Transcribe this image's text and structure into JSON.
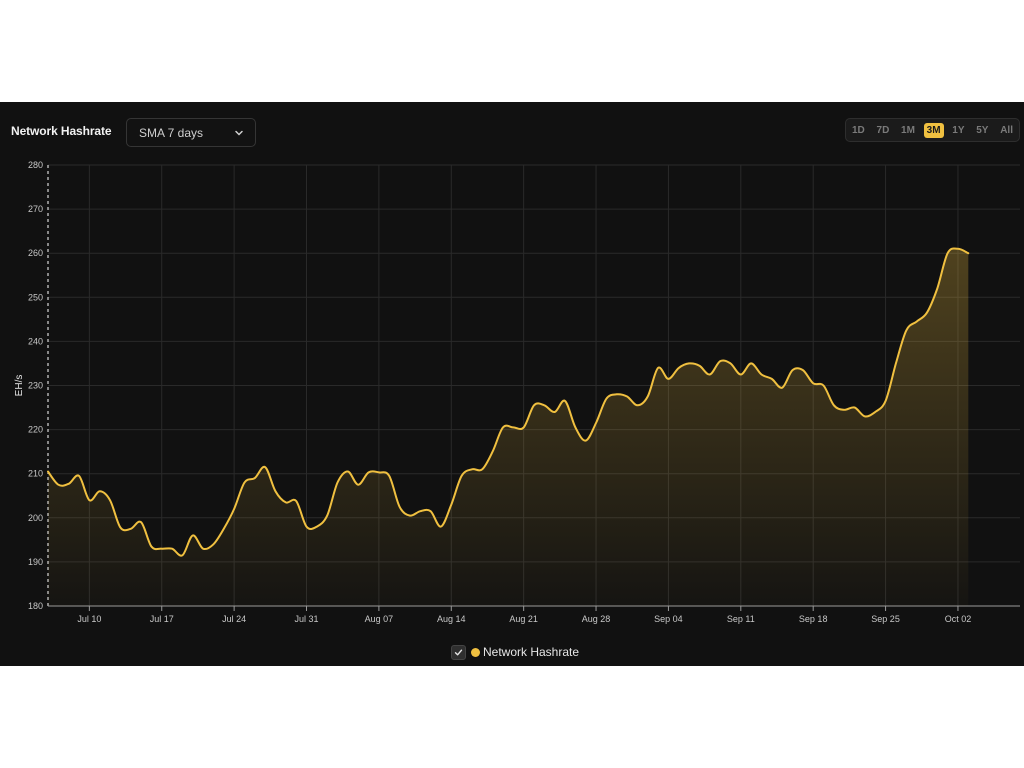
{
  "header": {
    "title": "Network Hashrate",
    "select_value": "SMA 7 days"
  },
  "ranges": [
    {
      "label": "1D",
      "active": false
    },
    {
      "label": "7D",
      "active": false
    },
    {
      "label": "1M",
      "active": false
    },
    {
      "label": "3M",
      "active": true
    },
    {
      "label": "1Y",
      "active": false
    },
    {
      "label": "5Y",
      "active": false
    },
    {
      "label": "All",
      "active": false
    }
  ],
  "colors": {
    "accent": "#f0c040",
    "background": "#111111",
    "grid": "#2a2a2a"
  },
  "legend": {
    "label": "Network Hashrate",
    "checked": true
  },
  "chart_data": {
    "type": "area",
    "ylabel": "EH/s",
    "ylim": [
      180,
      280
    ],
    "yticks": [
      180,
      190,
      200,
      210,
      220,
      230,
      240,
      250,
      260,
      270,
      280
    ],
    "xlim": [
      "2023-07-06",
      "2023-10-08"
    ],
    "xticks": [
      {
        "date": "2023-07-10",
        "label": "Jul 10"
      },
      {
        "date": "2023-07-17",
        "label": "Jul 17"
      },
      {
        "date": "2023-07-24",
        "label": "Jul 24"
      },
      {
        "date": "2023-07-31",
        "label": "Jul 31"
      },
      {
        "date": "2023-08-07",
        "label": "Aug 07"
      },
      {
        "date": "2023-08-14",
        "label": "Aug 14"
      },
      {
        "date": "2023-08-21",
        "label": "Aug 21"
      },
      {
        "date": "2023-08-28",
        "label": "Aug 28"
      },
      {
        "date": "2023-09-04",
        "label": "Sep 04"
      },
      {
        "date": "2023-09-11",
        "label": "Sep 11"
      },
      {
        "date": "2023-09-18",
        "label": "Sep 18"
      },
      {
        "date": "2023-09-25",
        "label": "Sep 25"
      },
      {
        "date": "2023-10-02",
        "label": "Oct 02"
      }
    ],
    "grid": true,
    "legend_position": "bottom-center",
    "series": [
      {
        "name": "Network Hashrate",
        "points": [
          [
            "2023-07-06",
            210.5
          ],
          [
            "2023-07-07",
            207.5
          ],
          [
            "2023-07-08",
            207.7
          ],
          [
            "2023-07-09",
            209.5
          ],
          [
            "2023-07-10",
            204.0
          ],
          [
            "2023-07-11",
            206.0
          ],
          [
            "2023-07-12",
            204.0
          ],
          [
            "2023-07-13",
            197.8
          ],
          [
            "2023-07-14",
            197.5
          ],
          [
            "2023-07-15",
            199.0
          ],
          [
            "2023-07-16",
            193.5
          ],
          [
            "2023-07-17",
            193.0
          ],
          [
            "2023-07-18",
            193.0
          ],
          [
            "2023-07-19",
            191.5
          ],
          [
            "2023-07-20",
            196.0
          ],
          [
            "2023-07-21",
            193.0
          ],
          [
            "2023-07-22",
            194.0
          ],
          [
            "2023-07-23",
            197.5
          ],
          [
            "2023-07-24",
            202.0
          ],
          [
            "2023-07-25",
            208.0
          ],
          [
            "2023-07-26",
            209.0
          ],
          [
            "2023-07-27",
            211.5
          ],
          [
            "2023-07-28",
            206.0
          ],
          [
            "2023-07-29",
            203.5
          ],
          [
            "2023-07-30",
            203.8
          ],
          [
            "2023-07-31",
            198.0
          ],
          [
            "2023-08-01",
            198.0
          ],
          [
            "2023-08-02",
            200.5
          ],
          [
            "2023-08-03",
            208.0
          ],
          [
            "2023-08-04",
            210.5
          ],
          [
            "2023-08-05",
            207.5
          ],
          [
            "2023-08-06",
            210.3
          ],
          [
            "2023-08-07",
            210.3
          ],
          [
            "2023-08-08",
            209.5
          ],
          [
            "2023-08-09",
            202.5
          ],
          [
            "2023-08-10",
            200.5
          ],
          [
            "2023-08-11",
            201.5
          ],
          [
            "2023-08-12",
            201.5
          ],
          [
            "2023-08-13",
            198.0
          ],
          [
            "2023-08-14",
            203.0
          ],
          [
            "2023-08-15",
            209.5
          ],
          [
            "2023-08-16",
            211.0
          ],
          [
            "2023-08-17",
            211.0
          ],
          [
            "2023-08-18",
            215.0
          ],
          [
            "2023-08-19",
            220.5
          ],
          [
            "2023-08-20",
            220.5
          ],
          [
            "2023-08-21",
            220.5
          ],
          [
            "2023-08-22",
            225.5
          ],
          [
            "2023-08-23",
            225.5
          ],
          [
            "2023-08-24",
            224.0
          ],
          [
            "2023-08-25",
            226.5
          ],
          [
            "2023-08-26",
            220.5
          ],
          [
            "2023-08-27",
            217.5
          ],
          [
            "2023-08-28",
            221.5
          ],
          [
            "2023-08-29",
            227.0
          ],
          [
            "2023-08-30",
            228.0
          ],
          [
            "2023-08-31",
            227.5
          ],
          [
            "2023-09-01",
            225.5
          ],
          [
            "2023-09-02",
            227.5
          ],
          [
            "2023-09-03",
            234.0
          ],
          [
            "2023-09-04",
            231.5
          ],
          [
            "2023-09-05",
            234.0
          ],
          [
            "2023-09-06",
            235.0
          ],
          [
            "2023-09-07",
            234.5
          ],
          [
            "2023-09-08",
            232.5
          ],
          [
            "2023-09-09",
            235.5
          ],
          [
            "2023-09-10",
            235.0
          ],
          [
            "2023-09-11",
            232.5
          ],
          [
            "2023-09-12",
            235.0
          ],
          [
            "2023-09-13",
            232.5
          ],
          [
            "2023-09-14",
            231.5
          ],
          [
            "2023-09-15",
            229.5
          ],
          [
            "2023-09-16",
            233.5
          ],
          [
            "2023-09-17",
            233.5
          ],
          [
            "2023-09-18",
            230.5
          ],
          [
            "2023-09-19",
            230.0
          ],
          [
            "2023-09-20",
            225.5
          ],
          [
            "2023-09-21",
            224.5
          ],
          [
            "2023-09-22",
            225.0
          ],
          [
            "2023-09-23",
            223.0
          ],
          [
            "2023-09-24",
            224.0
          ],
          [
            "2023-09-25",
            226.5
          ],
          [
            "2023-09-26",
            235.0
          ],
          [
            "2023-09-27",
            242.5
          ],
          [
            "2023-09-28",
            244.5
          ],
          [
            "2023-09-29",
            246.5
          ],
          [
            "2023-09-30",
            252.0
          ],
          [
            "2023-10-01",
            260.0
          ],
          [
            "2023-10-02",
            261.0
          ],
          [
            "2023-10-03",
            260.0
          ]
        ]
      }
    ]
  }
}
